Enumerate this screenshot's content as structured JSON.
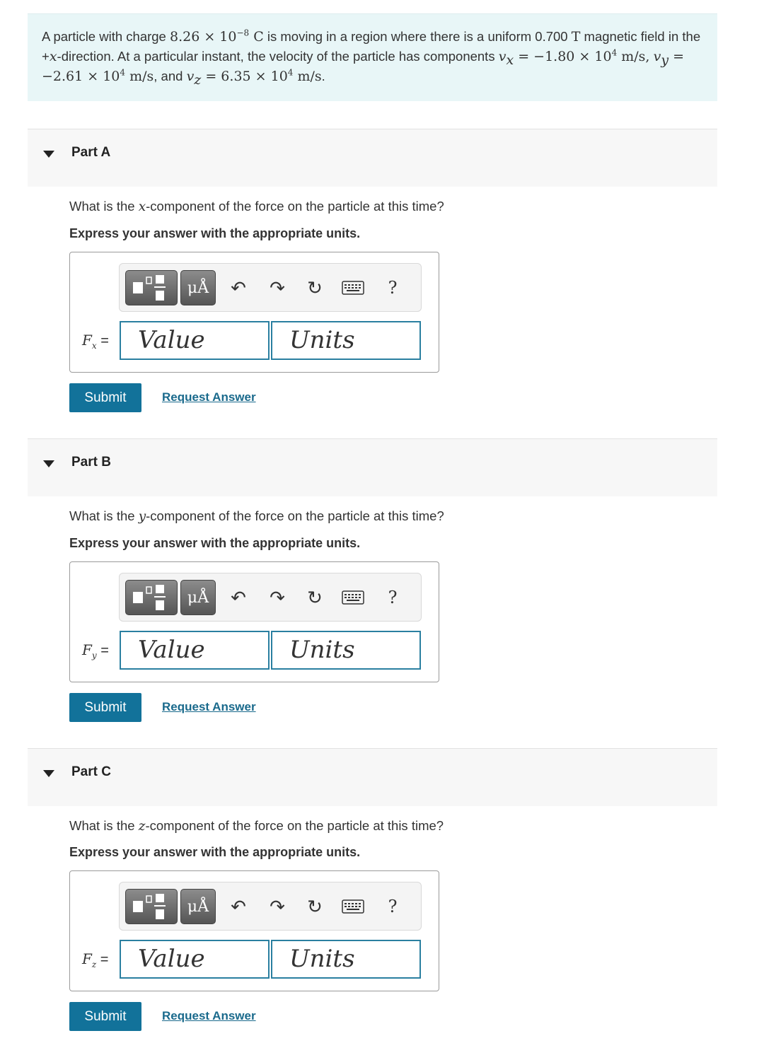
{
  "problem": {
    "t1": "A particle with charge ",
    "charge_value": "8.26 × 10",
    "charge_exp": "−8",
    "charge_unit": " C",
    "t2": " is moving in a region where there is a uniform 0.700 ",
    "field_unit": "T",
    "t3": " magnetic field in the +",
    "x_var": "x",
    "t4": "-direction. At a particular instant, the velocity of the particle has components ",
    "vx_var": "v",
    "vx_sub": "x",
    "vx_eq": " = −1.80 × 10",
    "vx_exp": "4",
    "vx_unit": " m/s,",
    "vy_var": "v",
    "vy_sub": "y",
    "vy_eq": " = −2.61 × 10",
    "vy_exp": "4",
    "vy_unit": " m/s",
    "t5": ", and ",
    "vz_var": "v",
    "vz_sub": "z",
    "vz_eq": " = 6.35 × 10",
    "vz_exp": "4",
    "vz_unit": " m/s",
    "t6": "."
  },
  "parts": [
    {
      "title": "Part A",
      "q_pre": "What is the ",
      "q_var": "x",
      "q_post": "-component of the force on the particle at this time?",
      "instruction": "Express your answer with the appropriate units.",
      "label_var": "F",
      "label_sub": "x",
      "label_eq": " =",
      "value_placeholder": "Value",
      "units_placeholder": "Units",
      "submit": "Submit",
      "request": "Request Answer"
    },
    {
      "title": "Part B",
      "q_pre": "What is the ",
      "q_var": "y",
      "q_post": "-component of the force on the particle at this time?",
      "instruction": "Express your answer with the appropriate units.",
      "label_var": "F",
      "label_sub": "y",
      "label_eq": " =",
      "value_placeholder": "Value",
      "units_placeholder": "Units",
      "submit": "Submit",
      "request": "Request Answer"
    },
    {
      "title": "Part C",
      "q_pre": "What is the ",
      "q_var": "z",
      "q_post": "-component of the force on the particle at this time?",
      "instruction": "Express your answer with the appropriate units.",
      "label_var": "F",
      "label_sub": "z",
      "label_eq": " =",
      "value_placeholder": "Value",
      "units_placeholder": "Units",
      "submit": "Submit",
      "request": "Request Answer"
    }
  ],
  "toolbar": {
    "units_button": "μÅ",
    "undo_icon": "undo-icon",
    "redo_icon": "redo-icon",
    "reset_icon": "reset-icon",
    "keyboard_icon": "keyboard-icon",
    "help_text": "?"
  },
  "colors": {
    "problem_bg": "#e8f6f7",
    "submit_bg": "#12729a",
    "link": "#1a6a8c",
    "input_border": "#2a7fa0"
  }
}
